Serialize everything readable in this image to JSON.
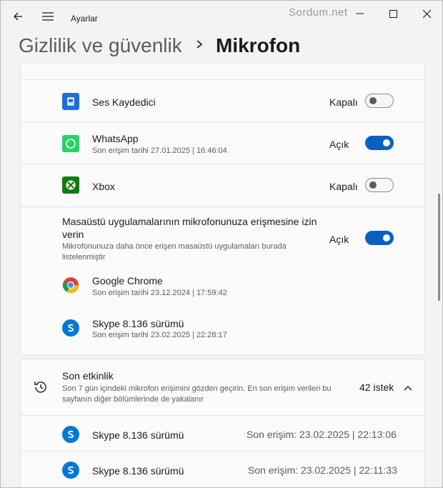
{
  "window": {
    "app_title": "Ayarlar",
    "watermark": "Sordum.net"
  },
  "header": {
    "breadcrumb_root": "Gizlilik ve güvenlik",
    "breadcrumb_current": "Mikrofon"
  },
  "apps": [
    {
      "name": "Ses Kaydedici",
      "sub": "",
      "state": "Kapalı",
      "on": false,
      "icon": "sound-recorder-icon"
    },
    {
      "name": "WhatsApp",
      "sub": "Son erişim tarihi 27.01.2025  |  16:46:04",
      "state": "Açık",
      "on": true,
      "icon": "whatsapp-icon"
    },
    {
      "name": "Xbox",
      "sub": "",
      "state": "Kapalı",
      "on": false,
      "icon": "xbox-icon"
    }
  ],
  "desktop": {
    "title": "Masaüstü uygulamalarının mikrofonunuza erişmesine izin verin",
    "description": "Mikrofonunuza daha önce erişen masaüstü uygulamaları burada listelenmiştir",
    "state": "Açık",
    "on": true,
    "apps": [
      {
        "name": "Google Chrome",
        "sub": "Son erişim tarihi 23.12.2024  |  17:59:42",
        "icon": "chrome-icon"
      },
      {
        "name": "Skype 8.136 sürümü",
        "sub": "Son erişim tarihi 23.02.2025  |  22:28:17",
        "icon": "skype-icon"
      }
    ]
  },
  "activity": {
    "title": "Son etkinlik",
    "description": "Son 7 gün içindeki mikrofon erişimini gözden geçirin. En son erişim verileri bu sayfanın diğer bölümlerinde de yakalanır",
    "count": "42 istek",
    "entries": [
      {
        "name": "Skype 8.136 sürümü",
        "time": "Son erişim: 23.02.2025  |  22:13:06"
      },
      {
        "name": "Skype 8.136 sürümü",
        "time": "Son erişim: 23.02.2025  |  22:11:33"
      }
    ]
  },
  "colors": {
    "accent": "#0a60c2",
    "whatsapp": "#25d366",
    "xbox": "#107c10",
    "skype": "#0078d4"
  }
}
